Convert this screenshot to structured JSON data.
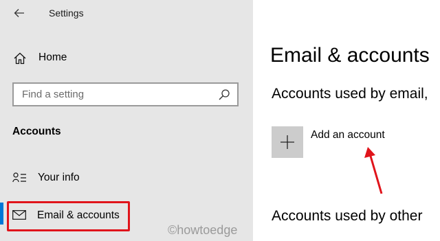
{
  "sidebar": {
    "app_title": "Settings",
    "home_label": "Home",
    "search_placeholder": "Find a setting",
    "section_header": "Accounts",
    "items": [
      {
        "label": "Your info",
        "icon": "person-list-icon"
      },
      {
        "label": "Email & accounts",
        "icon": "mail-icon",
        "selected": true
      }
    ]
  },
  "main": {
    "title": "Email & accounts",
    "email_section_header": "Accounts used by email,",
    "add_account_label": "Add an account",
    "other_section_header": "Accounts used by other"
  },
  "watermark": "©howtoedge",
  "colors": {
    "sidebar_bg": "#e6e6e6",
    "accent": "#0078d7",
    "highlight_border": "#e0141b",
    "add_button_bg": "#cccccc"
  }
}
